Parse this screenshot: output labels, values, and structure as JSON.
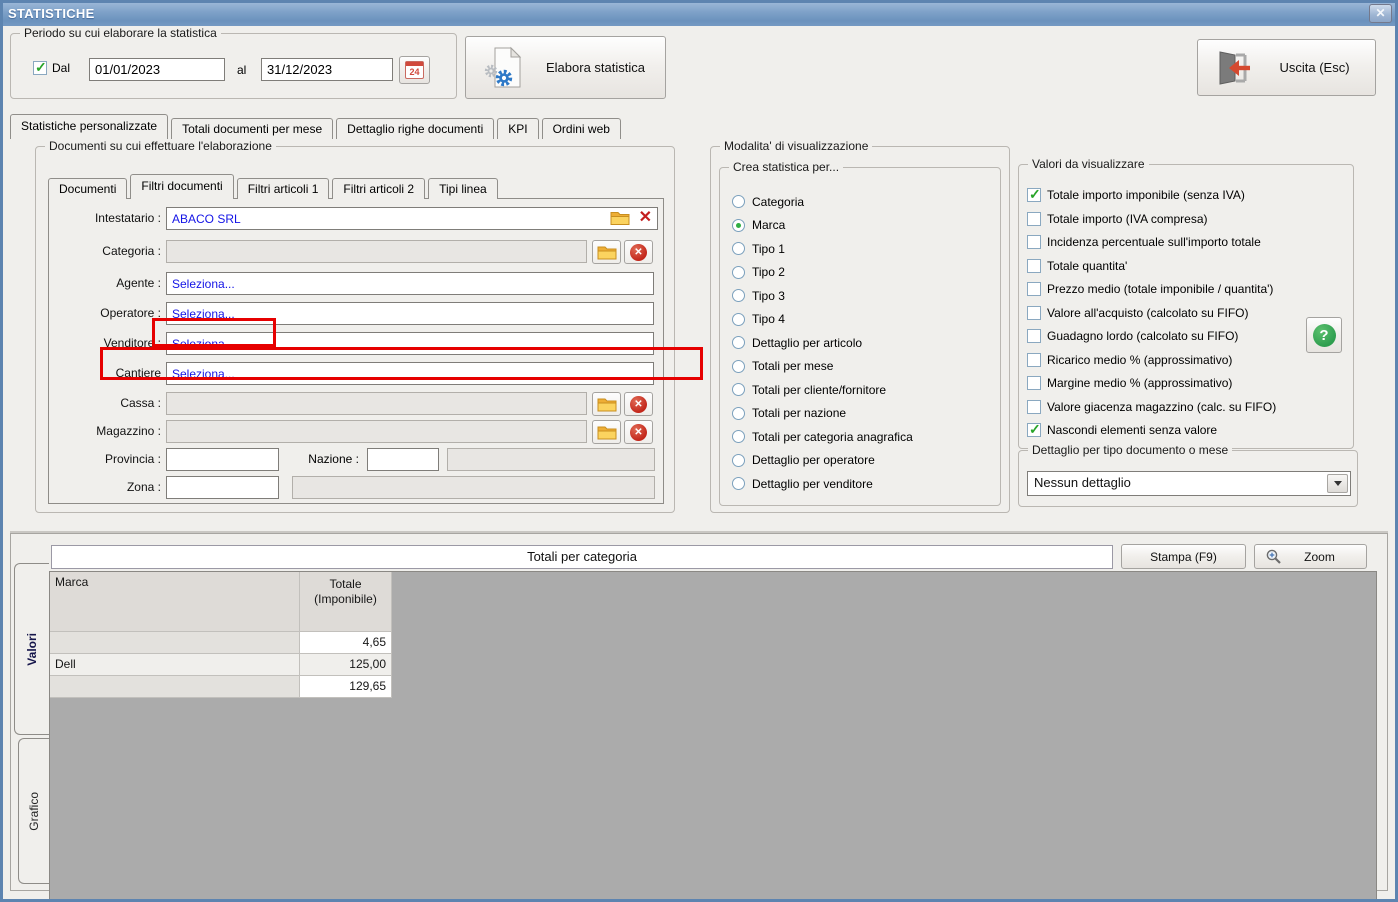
{
  "window": {
    "title": "STATISTICHE",
    "close_glyph": "✕"
  },
  "colors": {
    "titlebar_blue": "#7fa2c9",
    "window_border_blue": "#5d84b0",
    "link_blue": "#1414e6",
    "annotation_red": "#e60000",
    "folder_yellow": "#f6c44a",
    "error_red": "#c3271b",
    "selected_green": "#2fae43",
    "grid_gray": "#ababab"
  },
  "period": {
    "label": "Periodo su cui elaborare la statistica",
    "dal": "Dal",
    "from": "01/01/2023",
    "al": "al",
    "to": "31/12/2023",
    "calendar_day": "24"
  },
  "buttons": {
    "elabora": "Elabora statistica",
    "uscita": "Uscita (Esc)",
    "stampa": "Stampa (F9)",
    "zoom": "Zoom",
    "help": "?"
  },
  "main_tabs": [
    {
      "label": "Statistiche personalizzate",
      "on": true
    },
    {
      "label": "Totali documenti per mese",
      "on": false
    },
    {
      "label": "Dettaglio righe documenti",
      "on": false
    },
    {
      "label": "KPI",
      "on": false
    },
    {
      "label": "Ordini web",
      "on": false
    }
  ],
  "doc_group": {
    "label": "Documenti su cui effettuare l'elaborazione",
    "tabs": [
      {
        "label": "Documenti",
        "on": false
      },
      {
        "label": "Filtri documenti",
        "on": true
      },
      {
        "label": "Filtri articoli 1",
        "on": false
      },
      {
        "label": "Filtri articoli 2",
        "on": false
      },
      {
        "label": "Tipi linea",
        "on": false
      }
    ],
    "intestatario": {
      "label": "Intestatario :",
      "value": "ABACO SRL"
    },
    "categoria": {
      "label": "Categoria :",
      "value": ""
    },
    "agente": {
      "label": "Agente :",
      "value": "Seleziona..."
    },
    "operatore": {
      "label": "Operatore :",
      "value": "Seleziona..."
    },
    "venditore": {
      "label": "Venditore :",
      "value": "Seleziona..."
    },
    "cantiere": {
      "label": "Cantiere",
      "value": "Seleziona..."
    },
    "cassa": {
      "label": "Cassa :",
      "value": ""
    },
    "magazzino": {
      "label": "Magazzino :",
      "value": ""
    },
    "provincia": {
      "label": "Provincia :",
      "value": ""
    },
    "nazione": {
      "label": "Nazione :",
      "value": "",
      "desc": ""
    },
    "zona": {
      "label": "Zona :",
      "value": "",
      "desc": ""
    }
  },
  "modalita": {
    "label": "Modalita' di visualizzazione",
    "crea_label": "Crea statistica per...",
    "options": [
      {
        "label": "Categoria",
        "on": false
      },
      {
        "label": "Marca",
        "on": true
      },
      {
        "label": "Tipo 1",
        "on": false
      },
      {
        "label": "Tipo 2",
        "on": false
      },
      {
        "label": "Tipo 3",
        "on": false
      },
      {
        "label": "Tipo 4",
        "on": false
      },
      {
        "label": "Dettaglio per articolo",
        "on": false
      },
      {
        "label": "Totali per mese",
        "on": false
      },
      {
        "label": "Totali per cliente/fornitore",
        "on": false
      },
      {
        "label": "Totali per nazione",
        "on": false
      },
      {
        "label": "Totali per categoria anagrafica",
        "on": false
      },
      {
        "label": "Dettaglio per operatore",
        "on": false
      },
      {
        "label": "Dettaglio per venditore",
        "on": false
      }
    ]
  },
  "valori": {
    "label": "Valori da visualizzare",
    "options": [
      {
        "label": "Totale importo imponibile (senza IVA)",
        "on": true
      },
      {
        "label": "Totale importo (IVA compresa)",
        "on": false
      },
      {
        "label": "Incidenza percentuale sull'importo totale",
        "on": false
      },
      {
        "label": "Totale quantita'",
        "on": false
      },
      {
        "label": "Prezzo medio (totale imponibile / quantita')",
        "on": false
      },
      {
        "label": "Valore all'acquisto (calcolato su FIFO)",
        "on": false
      },
      {
        "label": "Guadagno lordo (calcolato su FIFO)",
        "on": false
      },
      {
        "label": "Ricarico medio % (approssimativo)",
        "on": false
      },
      {
        "label": "Margine medio % (approssimativo)",
        "on": false
      },
      {
        "label": "Valore giacenza magazzino (calc. su FIFO)",
        "on": false
      },
      {
        "label": "Nascondi elementi senza valore",
        "on": true
      }
    ]
  },
  "dettaglio": {
    "label": "Dettaglio per tipo documento o mese",
    "value": "Nessun dettaglio"
  },
  "results": {
    "banner": "Totali per categoria",
    "side_tabs": [
      "Valori",
      "Grafico"
    ],
    "table": {
      "columns": [
        "Marca",
        "Totale\n(Imponibile)"
      ],
      "rows": [
        [
          "",
          "4,65"
        ],
        [
          "Dell",
          "125,00"
        ],
        [
          "",
          "129,65"
        ]
      ]
    }
  }
}
